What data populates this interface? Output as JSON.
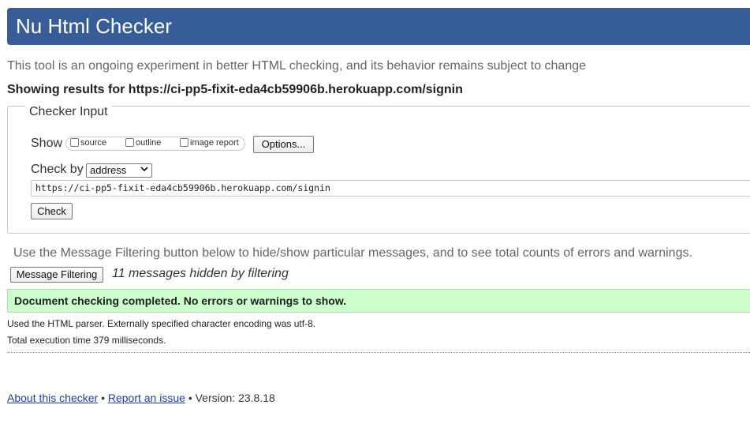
{
  "header": {
    "title": "Nu Html Checker"
  },
  "intro_text": "This tool is an ongoing experiment in better HTML checking, and its behavior remains subject to change",
  "showing_results": "Showing results for https://ci-pp5-fixit-eda4cb59906b.herokuapp.com/signin",
  "checker_input": {
    "legend": "Checker Input",
    "show_label": "Show",
    "show_options": [
      {
        "label": "source",
        "checked": false
      },
      {
        "label": "outline",
        "checked": false
      },
      {
        "label": "image report",
        "checked": false
      }
    ],
    "options_button": "Options...",
    "check_by_label": "Check by",
    "check_by_value": "address",
    "url_value": "https://ci-pp5-fixit-eda4cb59906b.herokuapp.com/signin",
    "check_button": "Check"
  },
  "filtering": {
    "note": "Use the Message Filtering button below to hide/show particular messages, and to see total counts of errors and warnings.",
    "button": "Message Filtering",
    "hidden_count": "11 messages hidden by filtering"
  },
  "result": {
    "success_message": "Document checking completed. No errors or warnings to show.",
    "parser_note": "Used the HTML parser. Externally specified character encoding was utf-8.",
    "execution_time": "Total execution time 379 milliseconds."
  },
  "footer": {
    "about_link": "About this checker",
    "separator": "•",
    "report_link": "Report an issue",
    "version": "Version: 23.8.18"
  },
  "colors": {
    "banner": "#365d95",
    "success_bg": "#ccffcc",
    "link": "#1a3fb0"
  }
}
